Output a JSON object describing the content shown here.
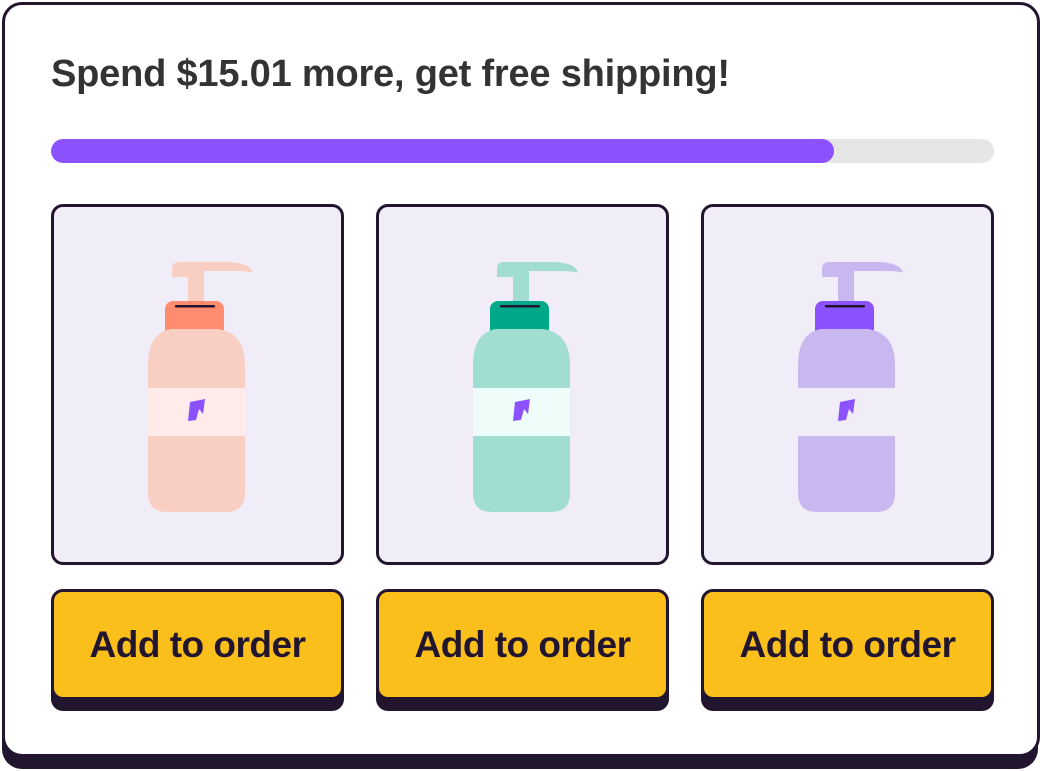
{
  "promo": {
    "headline": "Spend $15.01 more, get free shipping!",
    "progress_fraction": 0.83,
    "progress_color": "#8C52FF",
    "track_color": "#E6E6E6"
  },
  "products": [
    {
      "image_icon": "pump-bottle-icon",
      "pump_color": "#F9CFC4",
      "cap_color": "#FF8C6E",
      "body_color": "#F9CFC4",
      "label_color": "#FFECEA",
      "button_label": "Add to order"
    },
    {
      "image_icon": "pump-bottle-icon",
      "pump_color": "#A2DDD2",
      "cap_color": "#00A88A",
      "body_color": "#A2DDD2",
      "label_color": "#EEFDF9",
      "button_label": "Add to order"
    },
    {
      "image_icon": "pump-bottle-icon",
      "pump_color": "#C9B8F0",
      "cap_color": "#8C52FF",
      "body_color": "#C9B8F0",
      "label_color": "#F1EDF8",
      "button_label": "Add to order"
    }
  ],
  "colors": {
    "button": "#FBBF1C",
    "outline": "#22152E",
    "tile_background": "#F1EDF8",
    "logo": "#8C52FF"
  }
}
